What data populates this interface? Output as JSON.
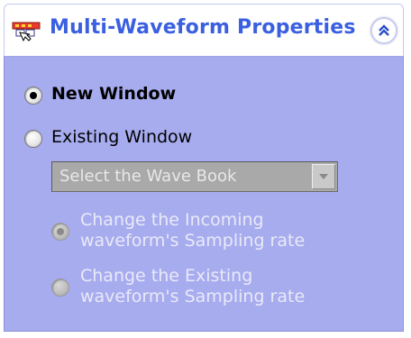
{
  "header": {
    "title": "Multi-Waveform Properties",
    "icon": "waveform-properties-icon",
    "collapse_icon": "double-chevron-up-icon",
    "title_color": "#3a5fe0"
  },
  "body": {
    "background_color": "#a7acef",
    "options": {
      "new_window": {
        "label": "New Window",
        "selected": true,
        "enabled": true
      },
      "existing_window": {
        "label": "Existing Window",
        "selected": false,
        "enabled": true
      }
    },
    "wave_book_select": {
      "placeholder": "Select the Wave Book",
      "enabled": false
    },
    "sampling": {
      "change_incoming": {
        "label": "Change the Incoming waveform's Sampling rate",
        "selected": true,
        "enabled": false
      },
      "change_existing": {
        "label": "Change the Existing waveform's Sampling rate",
        "selected": false,
        "enabled": false
      }
    }
  }
}
